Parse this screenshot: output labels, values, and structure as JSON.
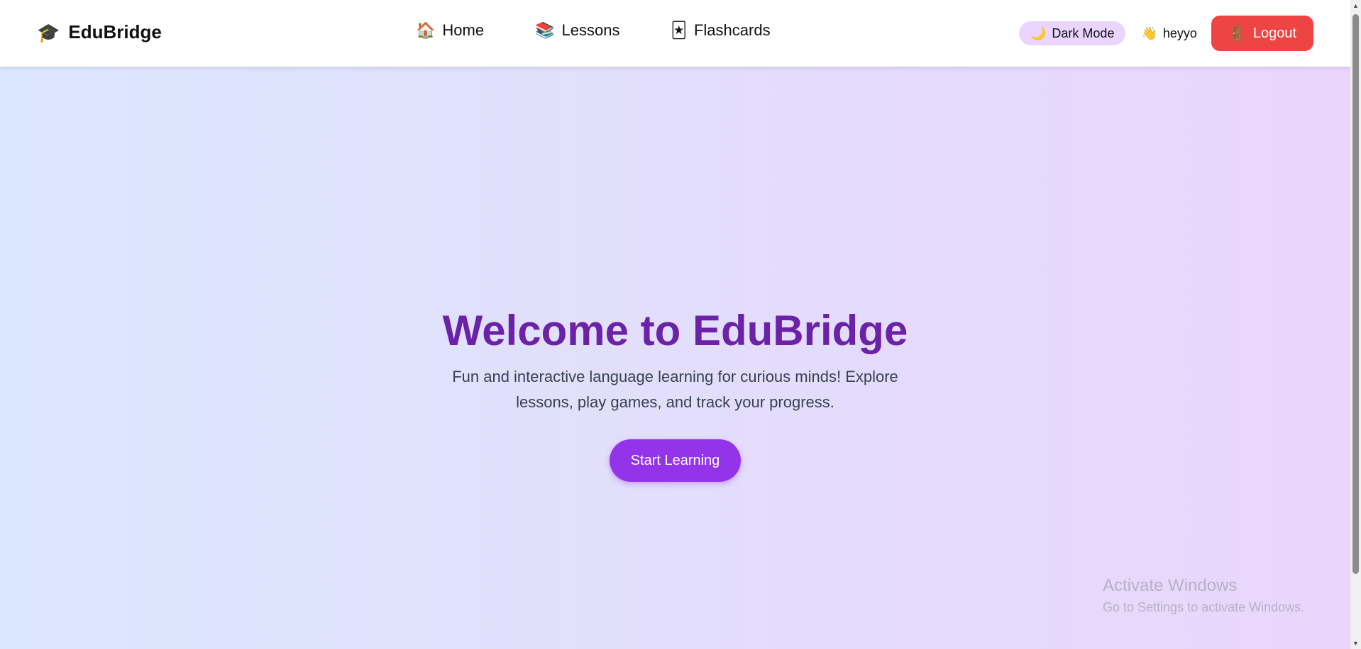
{
  "brand": {
    "icon": "🎓",
    "name": "EduBridge"
  },
  "nav": {
    "links": [
      {
        "icon": "🏠",
        "label": "Home"
      },
      {
        "icon": "📚",
        "label": "Lessons"
      },
      {
        "icon": "🃏",
        "label": "Flashcards"
      }
    ]
  },
  "header_right": {
    "dark_mode": {
      "icon": "🌙",
      "label": "Dark Mode"
    },
    "user": {
      "icon": "👋",
      "name": "heyyo"
    },
    "logout": {
      "icon": "🚪",
      "label": "Logout"
    }
  },
  "hero": {
    "title": "Welcome to EduBridge",
    "subtitle": "Fun and interactive language learning for curious minds! Explore lessons, play games, and track your progress.",
    "cta_label": "Start Learning"
  },
  "watermark": {
    "title": "Activate Windows",
    "subtitle": "Go to Settings to activate Windows."
  },
  "colors": {
    "brand_purple": "#6b21a8",
    "cta_purple": "#9333ea",
    "logout_red": "#ef4444",
    "toggle_bg": "#e9d5ff"
  }
}
